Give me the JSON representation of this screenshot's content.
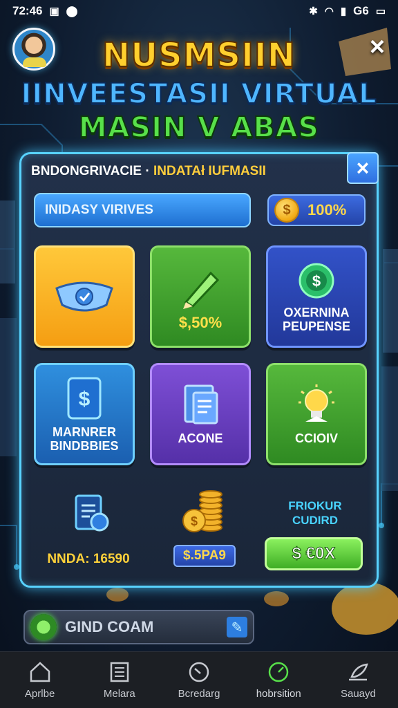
{
  "status_bar": {
    "time": "72:46",
    "network": "G6"
  },
  "header": {
    "title_line1": "NUSMSIIN",
    "title_line2": "IINVEESTASII VIRTUAL",
    "title_line3": "MASIN V ABAS",
    "close_icon": "×"
  },
  "panel": {
    "title_part1": "BNDONGRIVACIE ·",
    "title_part2": "INDATAł IUFMASII",
    "close_icon": "×",
    "field_value": "INIDASY VIRIVES",
    "percent_coin": "$",
    "percent_value": "100%",
    "tiles": [
      {
        "label": "",
        "icon": "badge-icon"
      },
      {
        "label": "$,50%",
        "icon": "pencil-icon"
      },
      {
        "label": "OXERNINA\nPEUPENSE",
        "icon": "dollar-target-icon"
      },
      {
        "label": "MARNRER\nBINDBBIES",
        "icon": "dollar-card-icon"
      },
      {
        "label": "ACONE",
        "icon": "document-icon"
      },
      {
        "label": "CCIOIV",
        "icon": "lightbulb-icon"
      }
    ],
    "stats_left_text": "NNDA: 16590",
    "stats_mid_price": "$.5PA9",
    "stats_right_label": "FRIOKUR\nCUDIRD",
    "go_button": "$ €0X"
  },
  "search": {
    "text": "GIND COAM"
  },
  "nav": {
    "items": [
      {
        "label": "Aprlbe",
        "icon": "home-icon"
      },
      {
        "label": "Melara",
        "icon": "list-icon"
      },
      {
        "label": "Bcredarg",
        "icon": "dial-icon"
      },
      {
        "label": "hobrsition",
        "icon": "compass-icon"
      },
      {
        "label": "Sauayd",
        "icon": "feather-icon"
      }
    ]
  },
  "colors": {
    "accent": "#58d2ff",
    "gold": "#ffcf2e",
    "green": "#58e04a"
  }
}
